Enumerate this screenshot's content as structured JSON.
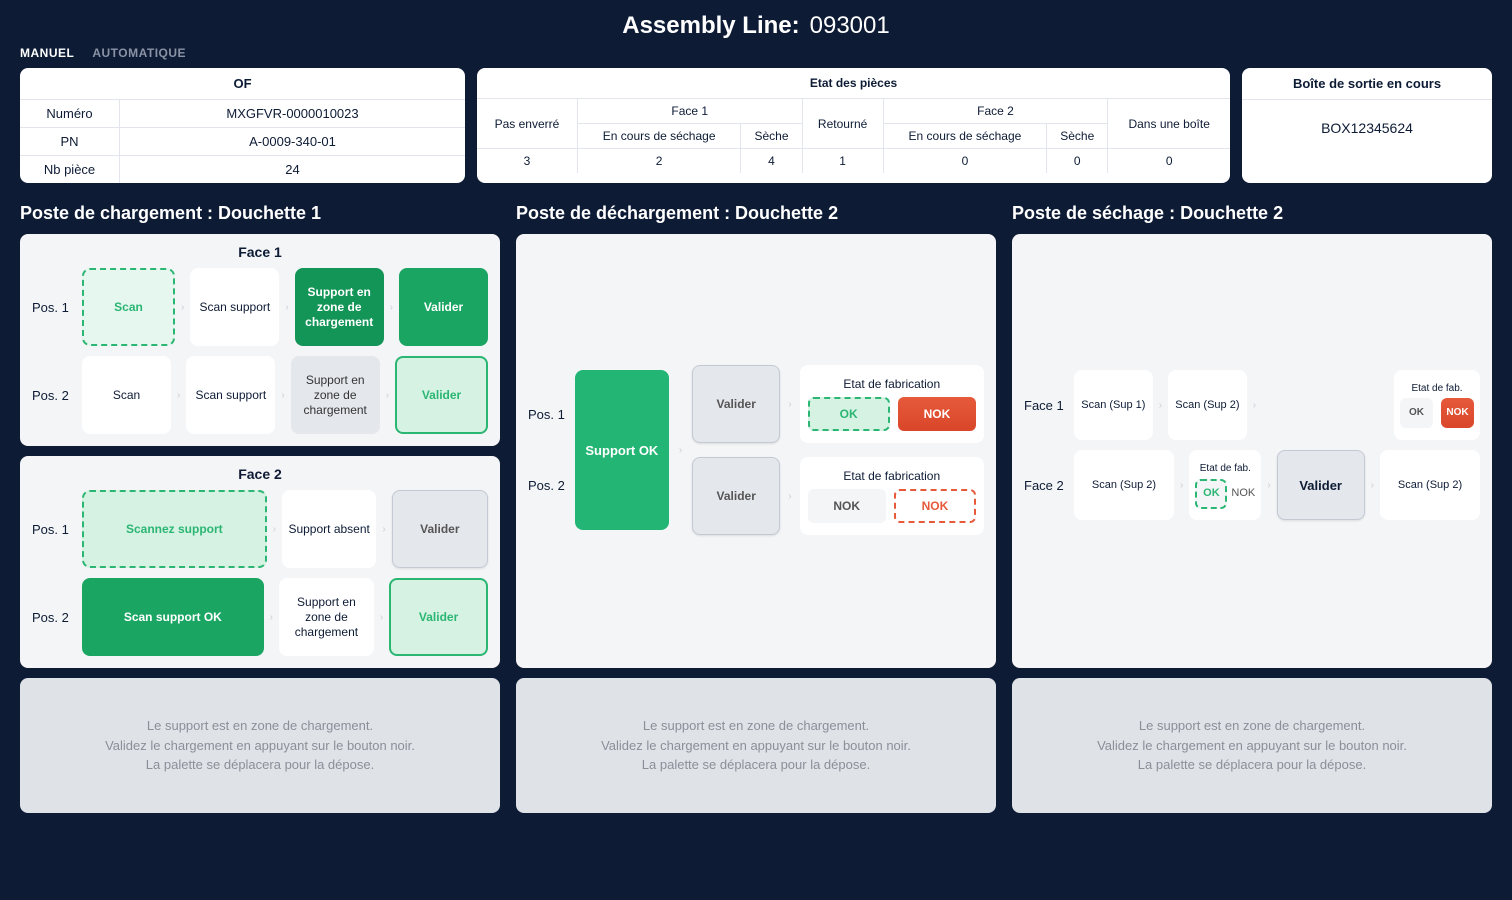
{
  "header": {
    "title": "Assembly Line:",
    "line": "093001"
  },
  "tabs": {
    "manual": "MANUEL",
    "auto": "AUTOMATIQUE"
  },
  "of": {
    "title": "OF",
    "numero_k": "Numéro",
    "numero_v": "MXGFVR-0000010023",
    "pn_k": "PN",
    "pn_v": "A-0009-340-01",
    "nb_k": "Nb pièce",
    "nb_v": "24"
  },
  "etat": {
    "title": "Etat des pièces",
    "pas_enverre": "Pas enverré",
    "face1": "Face 1",
    "face2": "Face 2",
    "en_cours": "En cours de séchage",
    "seche": "Sèche",
    "retourne": "Retourné",
    "dans_boite": "Dans une boîte",
    "vals": {
      "pas": "3",
      "f1c": "2",
      "f1s": "4",
      "ret": "1",
      "f2c": "0",
      "f2s": "0",
      "box": "0"
    }
  },
  "boite": {
    "title": "Boîte de sortie en cours",
    "val": "BOX12345624"
  },
  "col1": {
    "title": "Poste de chargement : Douchette 1",
    "face1": "Face 1",
    "face2": "Face 2",
    "pos1": "Pos. 1",
    "pos2": "Pos. 2",
    "scan": "Scan",
    "scan_support": "Scan support",
    "zone": "Support en zone de chargement",
    "valider": "Valider",
    "scannez_support": "Scannez support",
    "support_absent": "Support absent",
    "scan_support_ok": "Scan support OK"
  },
  "col2": {
    "title": "Poste de déchargement : Douchette 2",
    "pos1": "Pos. 1",
    "pos2": "Pos. 2",
    "support_ok": "Support OK",
    "valider": "Valider",
    "etat_fab": "Etat de fabrication",
    "ok": "OK",
    "nok": "NOK"
  },
  "col3": {
    "title": "Poste de séchage : Douchette 2",
    "face1": "Face 1",
    "face2": "Face 2",
    "scan_sup1": "Scan (Sup 1)",
    "scan_sup2": "Scan (Sup 2)",
    "etat_fab": "Etat de fab.",
    "ok": "OK",
    "nok": "NOK",
    "valider": "Valider"
  },
  "msg": {
    "l1": "Le support est en zone de chargement.",
    "l2": "Validez le chargement en appuyant sur le bouton noir.",
    "l3": "La palette se déplacera pour la dépose."
  }
}
